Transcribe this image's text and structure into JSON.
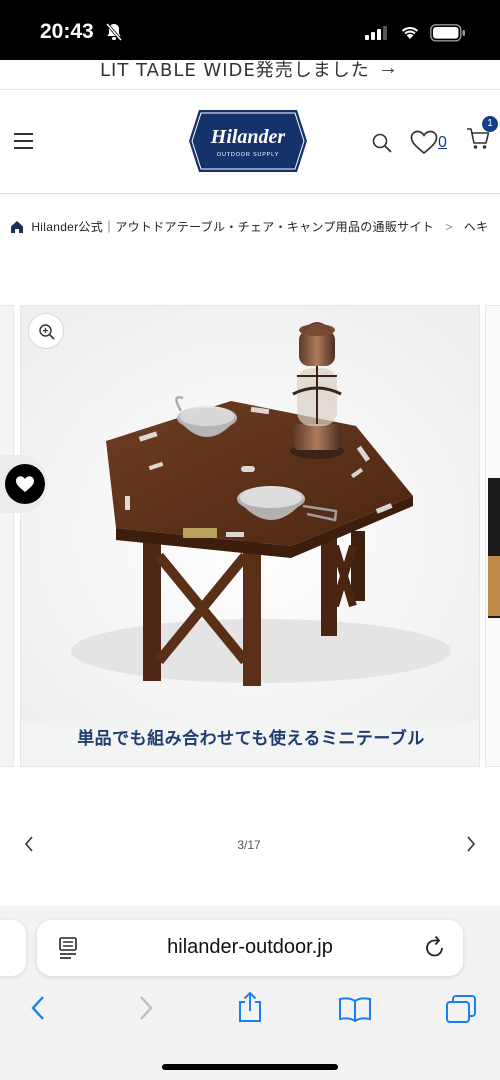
{
  "status_bar": {
    "time": "20:43"
  },
  "announcement": {
    "text": "LIT TABLE WIDE発売しました",
    "arrow": "→"
  },
  "header": {
    "logo_text": "Hilander",
    "logo_sub": "OUTDOOR SUPPLY",
    "wishlist_count": "0",
    "cart_count": "1",
    "brand_color": "#123f85"
  },
  "breadcrumb": {
    "items": [
      "Hilander公式｜アウトドアテーブル・チェア・キャンプ用品の通販サイト",
      "ヘキ"
    ],
    "separator": ">"
  },
  "gallery": {
    "caption": "単品でも組み合わせても使えるミニテーブル",
    "counter": "3/17"
  },
  "browser": {
    "url": "hilander-outdoor.jp"
  },
  "icons": [
    "bell-slash-icon",
    "signal-icon",
    "wifi-icon",
    "battery-icon",
    "menu-icon",
    "search-icon",
    "heart-icon",
    "cart-icon",
    "home-icon",
    "zoom-icon",
    "favorite-icon",
    "chevron-left-icon",
    "chevron-right-icon",
    "reader-icon",
    "reload-icon",
    "back-icon",
    "forward-icon",
    "share-icon",
    "bookmarks-icon",
    "tabs-icon"
  ]
}
